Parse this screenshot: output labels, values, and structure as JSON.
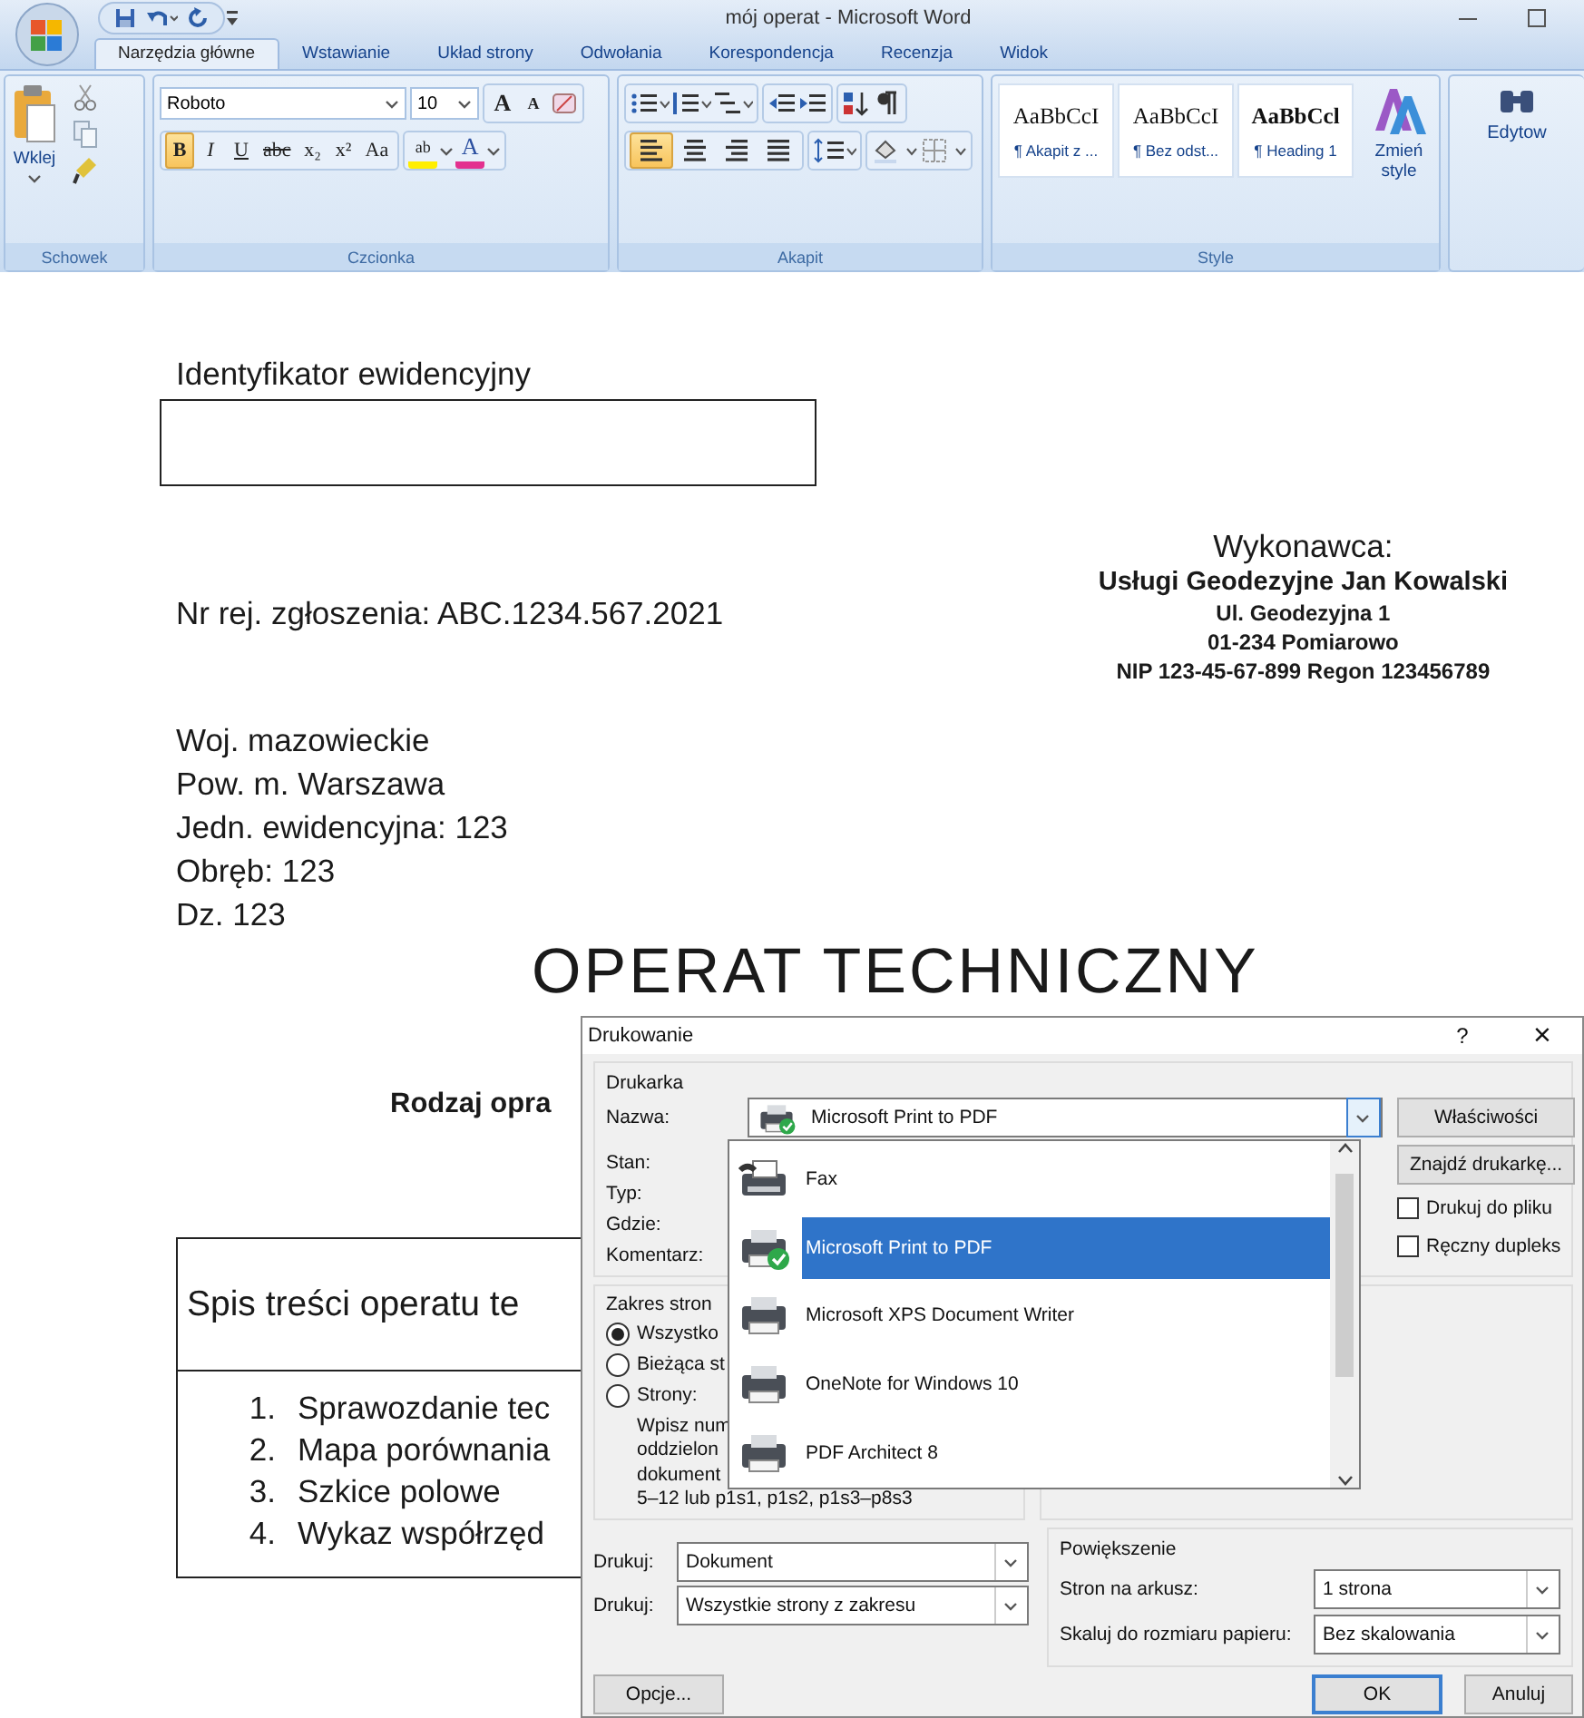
{
  "window": {
    "title": "mój operat - Microsoft Word"
  },
  "ribbon_tabs": [
    {
      "label": "Narzędzia główne",
      "selected": true
    },
    {
      "label": "Wstawianie",
      "selected": false
    },
    {
      "label": "Układ strony",
      "selected": false
    },
    {
      "label": "Odwołania",
      "selected": false
    },
    {
      "label": "Korespondencja",
      "selected": false
    },
    {
      "label": "Recenzja",
      "selected": false
    },
    {
      "label": "Widok",
      "selected": false
    }
  ],
  "ribbon": {
    "paste_label": "Wklej",
    "font_name": "Roboto",
    "font_size": "10",
    "grow_shrink": [
      "A",
      "A"
    ],
    "font_buttons": [
      {
        "label": "B",
        "active": true
      },
      {
        "label": "I",
        "active": false
      },
      {
        "label": "U",
        "active": false
      },
      {
        "label": "abc",
        "active": false
      },
      {
        "label": "x₂",
        "active": false
      },
      {
        "label": "x²",
        "active": false
      },
      {
        "label": "Aa",
        "active": false
      }
    ],
    "highlight_label": "ab",
    "font_color_label": "A",
    "alignment_buttons": [
      {
        "kind": "left",
        "selected": true
      },
      {
        "kind": "center",
        "selected": false
      },
      {
        "kind": "right",
        "selected": false
      },
      {
        "kind": "justify",
        "selected": false
      }
    ],
    "styles": [
      {
        "preview": "AaBbCcI",
        "label": "¶ Akapit z ..."
      },
      {
        "preview": "AaBbCcI",
        "label": "¶ Bez odst..."
      },
      {
        "preview": "AaBbCcl",
        "label": "¶ Heading 1"
      }
    ],
    "change_styles": "Zmień style",
    "editing": "Edytow",
    "group_labels": [
      "Schowek",
      "Czcionka",
      "Akapit",
      "Style"
    ]
  },
  "document": {
    "id_label": "Identyfikator ewidencyjny",
    "registration": "Nr rej. zgłoszenia: ABC.1234.567.2021",
    "contractor": {
      "heading": "Wykonawca:",
      "lines": [
        "Usługi Geodezyjne Jan Kowalski",
        "Ul. Geodezyjna 1",
        "01-234 Pomiarowo",
        "NIP 123-45-67-899 Regon 123456789"
      ]
    },
    "location": [
      "Woj. mazowieckie",
      "Pow. m. Warszawa",
      "Jedn. ewidencyjna: 123",
      "Obręb: 123",
      "Dz. 123"
    ],
    "title": "OPERAT TECHNICZNY",
    "subtitle": "Rodzaj opra",
    "toc": {
      "heading": "Spis treści operatu te",
      "items": [
        {
          "number": "1.",
          "text": "Sprawozdanie tec"
        },
        {
          "number": "2.",
          "text": "Mapa porównania"
        },
        {
          "number": "3.",
          "text": "Szkice polowe"
        },
        {
          "number": "4.",
          "text": "Wykaz współrzęd"
        }
      ]
    }
  },
  "print_dialog": {
    "title": "Drukowanie",
    "help": "?",
    "close": "×",
    "printer_group": "Drukarka",
    "name_label": "Nazwa:",
    "printer": "Microsoft Print to PDF",
    "info_labels": [
      "Stan:",
      "Typ:",
      "Gdzie:",
      "Komentarz:"
    ],
    "properties_button": "Właściwości",
    "find_button": "Znajdź drukarkę...",
    "options": [
      {
        "label": "Drukuj do pliku",
        "checked": false
      },
      {
        "label": "Ręczny dupleks",
        "checked": false
      }
    ],
    "printer_list": [
      {
        "name": "Fax",
        "kind": "fax",
        "default": false,
        "selected": false
      },
      {
        "name": "Microsoft Print to PDF",
        "kind": "printer",
        "default": true,
        "selected": true
      },
      {
        "name": "Microsoft XPS Document Writer",
        "kind": "printer",
        "default": false,
        "selected": false
      },
      {
        "name": "OneNote for Windows 10",
        "kind": "printer",
        "default": false,
        "selected": false
      },
      {
        "name": "PDF Architect 8",
        "kind": "printer",
        "default": false,
        "selected": false
      }
    ],
    "range": {
      "heading": "Zakres stron",
      "choices": [
        {
          "label": "Wszystko",
          "selected": true
        },
        {
          "label": "Bieżąca st",
          "selected": false
        },
        {
          "label": "Strony:",
          "selected": false
        }
      ],
      "hint": [
        "Wpisz num",
        "oddzielon",
        "dokument",
        "5–12 lub p1s1, p1s2, p1s3–p8s3"
      ]
    },
    "print_what": [
      {
        "label": "Drukuj:",
        "value": "Dokument"
      },
      {
        "label": "Drukuj:",
        "value": "Wszystkie strony z zakresu"
      }
    ],
    "zoom": {
      "heading": "Powiększenie",
      "rows": [
        {
          "label": "Stron na arkusz:",
          "value": "1 strona"
        },
        {
          "label": "Skaluj do rozmiaru papieru:",
          "value": "Bez skalowania"
        }
      ]
    },
    "buttons": {
      "options": "Opcje...",
      "ok": "OK",
      "cancel": "Anuluj"
    }
  }
}
